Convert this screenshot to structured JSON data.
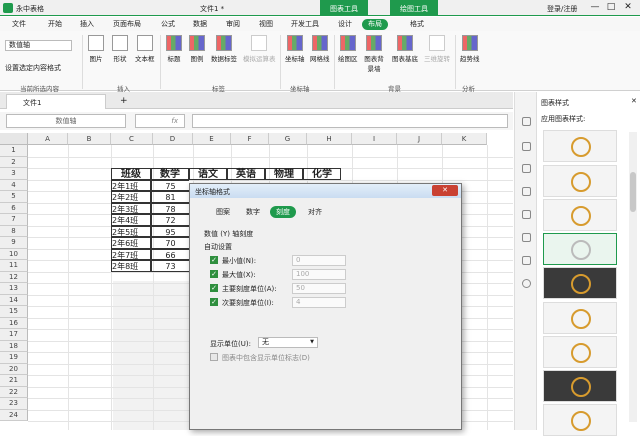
{
  "titlebar": {
    "app": "永中表格",
    "doc": "文件1 *",
    "ctx_tabs": [
      "图表工具",
      "绘图工具"
    ],
    "login": "登录/注册",
    "buttons": [
      "—",
      "□",
      "✕"
    ]
  },
  "menubar": {
    "items": [
      "文件",
      "开始",
      "插入",
      "页面布局",
      "公式",
      "数据",
      "审阅",
      "视图",
      "开发工具",
      "设计",
      "布局",
      "格式"
    ],
    "active": "布局"
  },
  "ribbon": {
    "left_select": "数值轴",
    "set_selected": "设置选定内容格式",
    "current_selection": "当前所选内容",
    "insert_buttons": [
      "图片",
      "形状",
      "文本框"
    ],
    "insert_label": "插入",
    "label_buttons": [
      "标题",
      "图例",
      "数据标签",
      "模拟运算表"
    ],
    "label_label": "标签",
    "axis_buttons": [
      "坐标轴",
      "网格线"
    ],
    "axis_label": "坐标轴",
    "bg_buttons": [
      "绘图区",
      "图表背景墙",
      "图表基底",
      "三维旋转"
    ],
    "bg_label": "背景",
    "analysis_buttons": [
      "趋势线"
    ],
    "analysis_label": "分析"
  },
  "filetabs": {
    "active": "文件1",
    "add": "+"
  },
  "formula": {
    "namebox": "数值轴",
    "fx": "fx"
  },
  "grid": {
    "columns": [
      "A",
      "B",
      "C",
      "D",
      "E",
      "F",
      "G",
      "H",
      "I",
      "J",
      "K"
    ],
    "rows": [
      "1",
      "2",
      "3",
      "4",
      "5",
      "6",
      "7",
      "8",
      "9",
      "10",
      "11",
      "12",
      "13",
      "14",
      "15",
      "16",
      "17",
      "18",
      "19",
      "20",
      "21",
      "22",
      "23",
      "24"
    ],
    "table_header": [
      "班级",
      "数学",
      "语文",
      "英语",
      "物理",
      "化学"
    ],
    "classes": [
      "2年1班",
      "2年2班",
      "2年3班",
      "2年4班",
      "2年5班",
      "2年6班",
      "2年7班",
      "2年8班"
    ],
    "math": [
      "75",
      "81",
      "78",
      "72",
      "95",
      "70",
      "66",
      "73"
    ]
  },
  "dialog": {
    "title": "坐标轴格式",
    "close": "✕",
    "tabs": [
      "图案",
      "数字",
      "刻度",
      "对齐"
    ],
    "active_tab": "刻度",
    "section": "数值 (Y) 轴刻度",
    "auto": "自动设置",
    "options": [
      {
        "label": "最小值(N):",
        "value": "0"
      },
      {
        "label": "最大值(X):",
        "value": "100"
      },
      {
        "label": "主要刻度单位(A):",
        "value": "50"
      },
      {
        "label": "次要刻度单位(I):",
        "value": "4"
      }
    ],
    "display_unit_label": "显示单位(U):",
    "display_unit_value": "无",
    "show_unit": "图表中包含显示单位标志(D)"
  },
  "panel": {
    "title": "图表样式",
    "sub": "应用图表样式:",
    "close": "✕"
  },
  "colors": {
    "accent": "#1f9a4d",
    "close": "#c94132"
  }
}
